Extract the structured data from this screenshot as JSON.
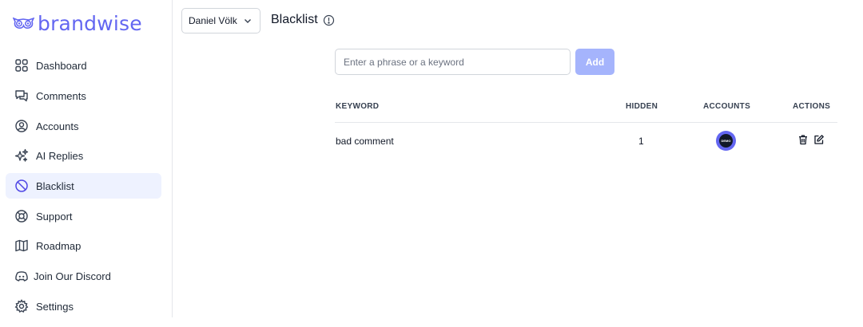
{
  "brand": {
    "name": "brandwise",
    "accent_color": "#6366f1"
  },
  "sidebar": {
    "items": [
      {
        "label": "Dashboard",
        "icon": "dashboard-icon"
      },
      {
        "label": "Comments",
        "icon": "comments-icon"
      },
      {
        "label": "Accounts",
        "icon": "accounts-icon"
      },
      {
        "label": "AI Replies",
        "icon": "sparkles-icon"
      },
      {
        "label": "Blacklist",
        "icon": "blacklist-icon",
        "active": true
      },
      {
        "label": "Support",
        "icon": "lifebuoy-icon"
      },
      {
        "label": "Roadmap",
        "icon": "map-icon"
      },
      {
        "label": "Join Our Discord",
        "icon": "discord-icon"
      },
      {
        "label": "Settings",
        "icon": "gear-icon"
      }
    ]
  },
  "header": {
    "account_selector": "Daniel Völk",
    "title": "Blacklist"
  },
  "form": {
    "placeholder": "Enter a phrase or a keyword",
    "value": "",
    "add_label": "Add"
  },
  "table": {
    "headers": {
      "keyword": "KEYWORD",
      "hidden": "HIDDEN",
      "accounts": "ACCOUNTS",
      "actions": "ACTIONS"
    },
    "rows": [
      {
        "keyword": "bad comment",
        "hidden": "1",
        "account_avatar_text": "DEMO"
      }
    ]
  }
}
